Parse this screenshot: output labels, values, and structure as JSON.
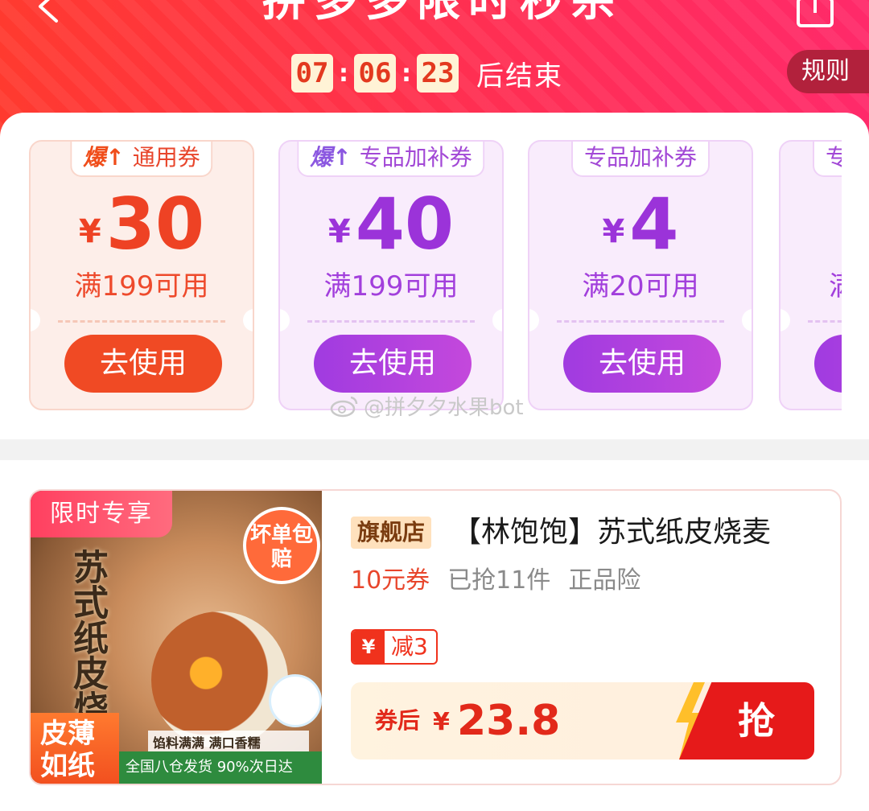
{
  "header": {
    "title": "拼多多限时秒杀",
    "countdown": {
      "hours": "07",
      "minutes": "06",
      "seconds": "23",
      "separator": ":",
      "suffix": "后结束"
    },
    "rules_label": "规则"
  },
  "coupons": [
    {
      "hot_label": "爆↑",
      "type_label": "通用券",
      "currency": "¥",
      "amount": "30",
      "condition": "满199可用",
      "button": "去使用"
    },
    {
      "hot_label": "爆↑",
      "type_label": "专品加补券",
      "currency": "¥",
      "amount": "40",
      "condition": "满199可用",
      "button": "去使用"
    },
    {
      "hot_label": "",
      "type_label": "专品加补券",
      "currency": "¥",
      "amount": "4",
      "condition": "满20可用",
      "button": "去使用"
    },
    {
      "hot_label": "",
      "type_label": "专",
      "currency": "",
      "amount": "",
      "condition": "满",
      "button": ""
    }
  ],
  "watermark": "@拼夕夕水果bot",
  "product": {
    "image": {
      "promo_tag": "限时专享",
      "calligraphy": "苏式纸皮烧麦",
      "badge": "坏单包赔",
      "side_label": "皮薄如纸",
      "caption": "馅料满满 满口香糯",
      "bottom_strip": "全国八仓发货 90%次日达"
    },
    "store_badge": "旗舰店",
    "title": "【林饱饱】苏式纸皮烧麦",
    "meta": {
      "coupon": "10元券",
      "sold": "已抢11件",
      "insurance": "正品险"
    },
    "discount": {
      "icon": "¥",
      "text": "减3"
    },
    "price": {
      "label": "券后",
      "currency": "¥",
      "value": "23.8"
    },
    "grab_label": "抢"
  },
  "colors": {
    "header_red": "#ff2f52",
    "coupon_orange": "#ee4224",
    "coupon_purple": "#9b33d9",
    "price_red": "#e2291a"
  }
}
